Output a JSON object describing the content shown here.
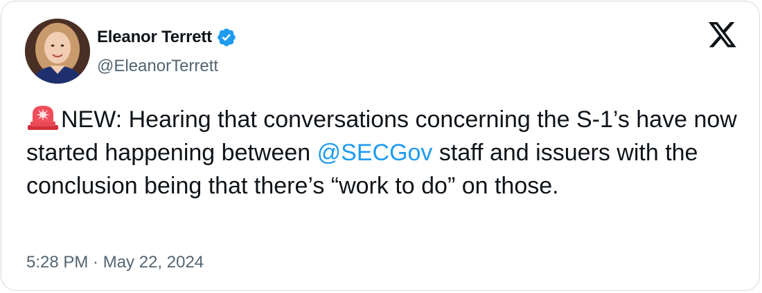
{
  "author": {
    "name": "Eleanor Terrett",
    "handle": "@EleanorTerrett",
    "verified": true,
    "avatar_icon": "profile-photo"
  },
  "tweet": {
    "emoji_icon": "rotating-light-icon",
    "text_before_mention": "NEW: Hearing that conversations concerning the S-1’s have now started happening between ",
    "mention": "@SECGov",
    "text_after_mention": " staff and issuers with the conclusion being that there’s “work to do” on those."
  },
  "timestamp": "5:28 PM · May 22, 2024",
  "platform_icon": "x-logo-icon",
  "colors": {
    "text": "#0f1419",
    "secondary": "#536471",
    "link": "#1d9bf0",
    "verified_badge": "#1d9bf0",
    "border": "#cfd9de"
  }
}
